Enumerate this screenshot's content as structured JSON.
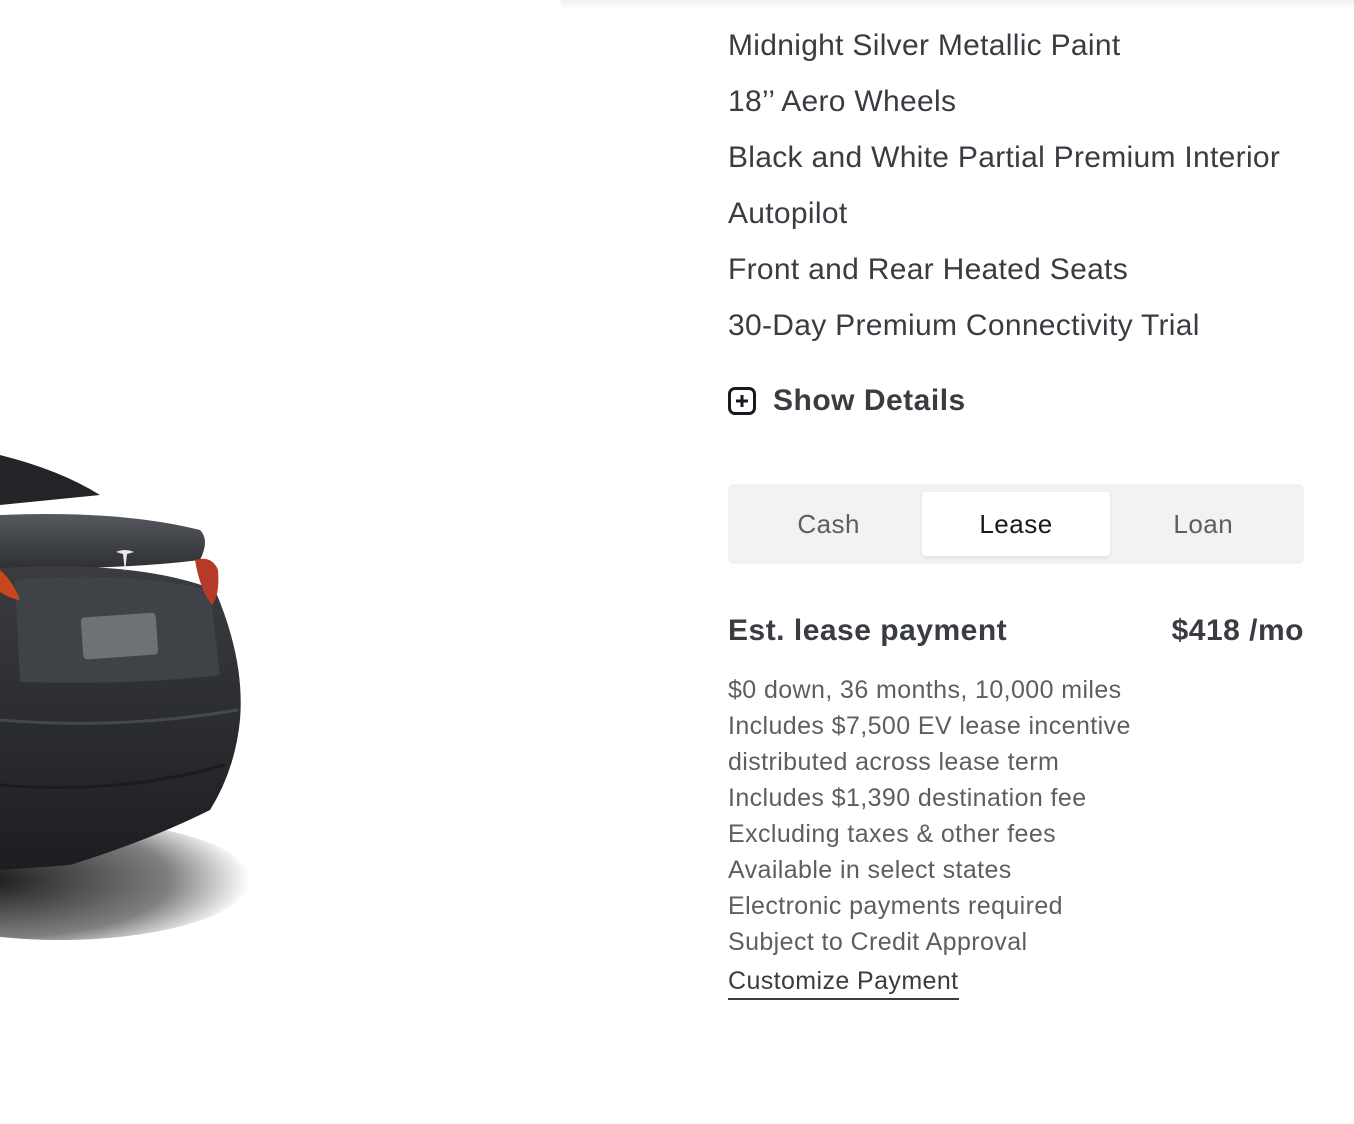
{
  "features": [
    "Midnight Silver Metallic Paint",
    "18’’ Aero Wheels",
    "Black and White Partial Premium Interior",
    "Autopilot",
    "Front and Rear Heated Seats",
    "30-Day Premium Connectivity Trial"
  ],
  "show_details": {
    "label": "Show Details",
    "icon": "plus-square-icon"
  },
  "payment_tabs": [
    {
      "label": "Cash",
      "active": false
    },
    {
      "label": "Lease",
      "active": true
    },
    {
      "label": "Loan",
      "active": false
    }
  ],
  "lease": {
    "label": "Est. lease payment",
    "value": "$418 /mo",
    "terms": [
      "$0 down, 36 months, 10,000 miles",
      "Includes $7,500 EV lease incentive",
      "distributed across lease term",
      "Includes $1,390 destination fee",
      "Excluding taxes & other fees",
      "Available in select states",
      "Electronic payments required",
      "Subject to Credit Approval"
    ],
    "customize_label": "Customize Payment"
  },
  "colors": {
    "text_primary": "#393c41",
    "text_secondary": "#5c5e62",
    "tab_background": "#f2f2f2",
    "active_tab_text": "#171a20",
    "car_body": "#2b2d30"
  }
}
